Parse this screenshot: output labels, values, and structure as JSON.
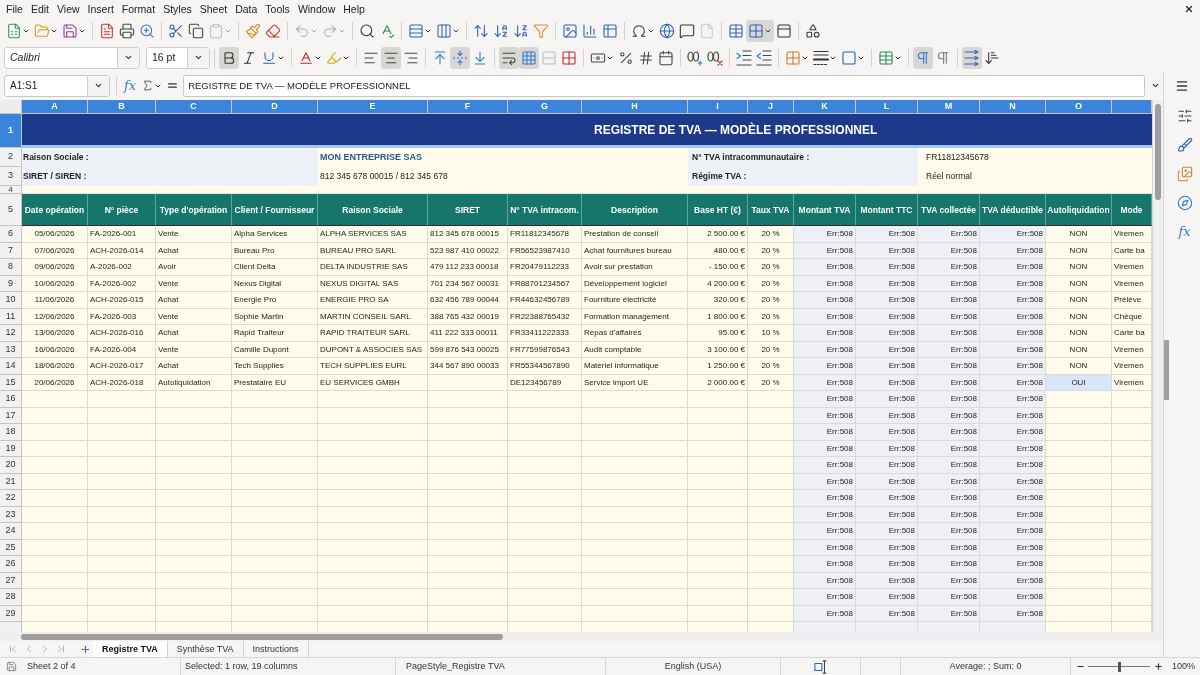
{
  "menu_bar": {
    "items": [
      "File",
      "Edit",
      "View",
      "Insert",
      "Format",
      "Styles",
      "Sheet",
      "Data",
      "Tools",
      "Window",
      "Help"
    ]
  },
  "standard_toolbar": {
    "buttons": [
      {
        "on": false,
        "disabled": false
      },
      {
        "on": false,
        "disabled": false
      },
      {
        "on": false,
        "disabled": false
      },
      {
        "on": false,
        "disabled": false
      },
      {
        "on": false,
        "disabled": false
      },
      {
        "on": false,
        "disabled": false
      },
      {
        "on": false,
        "disabled": false
      },
      {
        "on": false,
        "disabled": false
      },
      {
        "on": false,
        "disabled": true
      },
      {
        "on": false,
        "disabled": false
      },
      {
        "on": false,
        "disabled": false
      },
      {
        "on": false,
        "disabled": true
      },
      {
        "on": false,
        "disabled": true
      },
      {
        "on": false,
        "disabled": false
      },
      {
        "on": false,
        "disabled": false
      },
      {
        "on": false,
        "disabled": false
      },
      {
        "on": false,
        "disabled": false
      },
      {
        "on": false,
        "disabled": false
      },
      {
        "on": false,
        "disabled": false
      },
      {
        "on": false,
        "disabled": false
      },
      {
        "on": false,
        "disabled": false
      },
      {
        "on": false,
        "disabled": false
      },
      {
        "on": false,
        "disabled": false
      },
      {
        "on": false,
        "disabled": false
      },
      {
        "on": false,
        "disabled": false
      },
      {
        "on": false,
        "disabled": false
      },
      {
        "on": false,
        "disabled": false
      },
      {
        "on": false,
        "disabled": true
      },
      {
        "on": false,
        "disabled": false
      },
      {
        "on": true,
        "disabled": false
      },
      {
        "on": false,
        "disabled": false
      },
      {
        "on": false,
        "disabled": false
      }
    ]
  },
  "formatting_toolbar": {
    "font_name": "Calibri",
    "font_size": "16 pt",
    "buttons": [
      {
        "on": true,
        "disabled": false
      },
      {
        "on": false,
        "disabled": false
      },
      {
        "on": false,
        "disabled": false
      },
      {
        "on": false,
        "disabled": false
      },
      {
        "on": false,
        "disabled": false
      },
      {
        "on": false,
        "disabled": false
      },
      {
        "on": true,
        "disabled": false
      },
      {
        "on": false,
        "disabled": false
      },
      {
        "on": false,
        "disabled": false
      },
      {
        "on": true,
        "disabled": false
      },
      {
        "on": false,
        "disabled": false
      },
      {
        "on": true,
        "disabled": false
      },
      {
        "on": true,
        "disabled": false
      },
      {
        "on": false,
        "disabled": true
      },
      {
        "on": false,
        "disabled": false
      },
      {
        "on": false,
        "disabled": false
      },
      {
        "on": false,
        "disabled": false
      },
      {
        "on": false,
        "disabled": false
      },
      {
        "on": false,
        "disabled": false
      },
      {
        "on": false,
        "disabled": false
      },
      {
        "on": false,
        "disabled": false
      },
      {
        "on": false,
        "disabled": false
      },
      {
        "on": false,
        "disabled": false
      },
      {
        "on": false,
        "disabled": false
      },
      {
        "on": false,
        "disabled": false
      },
      {
        "on": false,
        "disabled": false
      },
      {
        "on": false,
        "disabled": false
      },
      {
        "on": true,
        "disabled": false
      },
      {
        "on": false,
        "disabled": false
      },
      {
        "on": true,
        "disabled": false
      },
      {
        "on": false,
        "disabled": false
      }
    ]
  },
  "formula_bar": {
    "name_box": "A1:S1",
    "function_wizard": "fx",
    "formula": "REGISTRE DE TVA — MODÈLE PROFESSIONNEL"
  },
  "sheet": {
    "columns": [
      {
        "letter": "A",
        "selected": true
      },
      {
        "letter": "B",
        "selected": true
      },
      {
        "letter": "C",
        "selected": true
      },
      {
        "letter": "D",
        "selected": true
      },
      {
        "letter": "E",
        "selected": true
      },
      {
        "letter": "F",
        "selected": true
      },
      {
        "letter": "G",
        "selected": true
      },
      {
        "letter": "H",
        "selected": true
      },
      {
        "letter": "I",
        "selected": true
      },
      {
        "letter": "J",
        "selected": true
      },
      {
        "letter": "K",
        "selected": true
      },
      {
        "letter": "L",
        "selected": true
      },
      {
        "letter": "M",
        "selected": true
      },
      {
        "letter": "N",
        "selected": true
      },
      {
        "letter": "O",
        "selected": true
      },
      {
        "selected": true
      }
    ],
    "title_row": {
      "row": "1",
      "selected": true,
      "title": "REGISTRE DE TVA — MODÈLE PROFESSIONNEL"
    },
    "info_rows": [
      {
        "row": "2",
        "selected": false,
        "label": "Raison Sociale :",
        "value": "MON ENTREPRISE SAS",
        "value_emphasis": true,
        "label_2": "N° TVA intracommunautaire :",
        "value_2": "FR11812345678"
      },
      {
        "row": "3",
        "selected": false,
        "label": "SIRET / SIREN :",
        "value": "812 345 678 00015 / 812 345 678",
        "value_emphasis": false,
        "label_2": "Régime TVA :",
        "value_2": "Réel normal"
      }
    ],
    "spacer_row": {
      "row": "4",
      "selected": false
    },
    "header_row": {
      "row": "5",
      "selected": false,
      "cells": [
        "Date opération",
        "N° pièce",
        "Type d'opération",
        "Client / Fournisseur",
        "Raison Sociale",
        "SIRET",
        "N° TVA intracom.",
        "Description",
        "Base HT (€)",
        "Taux TVA",
        "Montant TVA",
        "Montant TTC",
        "TVA collectée",
        "TVA déductible",
        "Autoliquidation",
        "Mode"
      ]
    },
    "rows": [
      {
        "row": "6",
        "selected": false,
        "autoliquidation_highlighted": false,
        "cells": {
          "date": "05/06/2026",
          "piece": "FA-2026-001",
          "type": "Vente",
          "client": "Alpha Services",
          "raison_sociale": "ALPHA SERVICES SAS",
          "siret": "812 345 678 00015",
          "tva_intracom": "FR11812345678",
          "description": "Prestation de conseil",
          "base_ht": "2 500.00 €",
          "taux_tva": "20 %",
          "montant_tva": "Err:508",
          "montant_ttc": "Err:508",
          "tva_collectee": "Err:508",
          "tva_deductible": "Err:508",
          "autoliquidation": "NON",
          "mode": "Viremen"
        }
      },
      {
        "row": "7",
        "selected": false,
        "autoliquidation_highlighted": false,
        "cells": {
          "date": "07/06/2026",
          "piece": "ACH-2026-014",
          "type": "Achat",
          "client": "Bureau Pro",
          "raison_sociale": "BUREAU PRO SARL",
          "siret": "523 987 410 00022",
          "tva_intracom": "FR56523987410",
          "description": "Achat fournitures bureau",
          "base_ht": "480.00 €",
          "taux_tva": "20 %",
          "montant_tva": "Err:508",
          "montant_ttc": "Err:508",
          "tva_collectee": "Err:508",
          "tva_deductible": "Err:508",
          "autoliquidation": "NON",
          "mode": "Carte ba"
        }
      },
      {
        "row": "8",
        "selected": false,
        "autoliquidation_highlighted": false,
        "cells": {
          "date": "09/06/2026",
          "piece": "A-2026-002",
          "type": "Avoir",
          "client": "Client Delta",
          "raison_sociale": "DELTA INDUSTRIE SAS",
          "siret": "479 112 233 00018",
          "tva_intracom": "FR20479112233",
          "description": "Avoir sur prestation",
          "base_ht": "- 150.00 €",
          "taux_tva": "20 %",
          "montant_tva": "Err:508",
          "montant_ttc": "Err:508",
          "tva_collectee": "Err:508",
          "tva_deductible": "Err:508",
          "autoliquidation": "NON",
          "mode": "Viremen"
        }
      },
      {
        "row": "9",
        "selected": false,
        "autoliquidation_highlighted": false,
        "cells": {
          "date": "10/06/2026",
          "piece": "FA-2026-002",
          "type": "Vente",
          "client": "Nexus Digital",
          "raison_sociale": "NEXUS DIGITAL SAS",
          "siret": "701 234 567 00031",
          "tva_intracom": "FR88701234567",
          "description": "Développement logiciel",
          "base_ht": "4 200.00 €",
          "taux_tva": "20 %",
          "montant_tva": "Err:508",
          "montant_ttc": "Err:508",
          "tva_collectee": "Err:508",
          "tva_deductible": "Err:508",
          "autoliquidation": "NON",
          "mode": "Viremen"
        }
      },
      {
        "row": "10",
        "selected": false,
        "autoliquidation_highlighted": false,
        "cells": {
          "date": "11/06/2026",
          "piece": "ACH-2026-015",
          "type": "Achat",
          "client": "Energie Pro",
          "raison_sociale": "ENERGIE PRO SA",
          "siret": "632 456 789 00044",
          "tva_intracom": "FR44632456789",
          "description": "Fourniture électricité",
          "base_ht": "320.00 €",
          "taux_tva": "20 %",
          "montant_tva": "Err:508",
          "montant_ttc": "Err:508",
          "tva_collectee": "Err:508",
          "tva_deductible": "Err:508",
          "autoliquidation": "NON",
          "mode": "Prélève"
        }
      },
      {
        "row": "11",
        "selected": false,
        "autoliquidation_highlighted": false,
        "cells": {
          "date": "12/06/2026",
          "piece": "FA-2026-003",
          "type": "Vente",
          "client": "Sophie Martin",
          "raison_sociale": "MARTIN CONSEIL SARL",
          "siret": "388 765 432 00019",
          "tva_intracom": "FR22388765432",
          "description": "Formation management",
          "base_ht": "1 800.00 €",
          "taux_tva": "20 %",
          "montant_tva": "Err:508",
          "montant_ttc": "Err:508",
          "tva_collectee": "Err:508",
          "tva_deductible": "Err:508",
          "autoliquidation": "NON",
          "mode": "Chèque"
        }
      },
      {
        "row": "12",
        "selected": false,
        "autoliquidation_highlighted": false,
        "cells": {
          "date": "13/06/2026",
          "piece": "ACH-2026-016",
          "type": "Achat",
          "client": "Rapid Traiteur",
          "raison_sociale": "RAPID TRAITEUR SARL",
          "siret": "411 222 333 00011",
          "tva_intracom": "FR33411222333",
          "description": "Repas d'affaires",
          "base_ht": "95.00 €",
          "taux_tva": "10 %",
          "montant_tva": "Err:508",
          "montant_ttc": "Err:508",
          "tva_collectee": "Err:508",
          "tva_deductible": "Err:508",
          "autoliquidation": "NON",
          "mode": "Carte ba"
        }
      },
      {
        "row": "13",
        "selected": false,
        "autoliquidation_highlighted": false,
        "cells": {
          "date": "16/06/2026",
          "piece": "FA-2026-004",
          "type": "Vente",
          "client": "Camille Dupont",
          "raison_sociale": "DUPONT & ASSOCIES SAS",
          "siret": "599 876 543 00025",
          "tva_intracom": "FR77599876543",
          "description": "Audit comptable",
          "base_ht": "3 100.00 €",
          "taux_tva": "20 %",
          "montant_tva": "Err:508",
          "montant_ttc": "Err:508",
          "tva_collectee": "Err:508",
          "tva_deductible": "Err:508",
          "autoliquidation": "NON",
          "mode": "Viremen"
        }
      },
      {
        "row": "14",
        "selected": false,
        "autoliquidation_highlighted": false,
        "cells": {
          "date": "18/06/2026",
          "piece": "ACH-2026-017",
          "type": "Achat",
          "client": "Tech Supplies",
          "raison_sociale": "TECH SUPPLIES EURL",
          "siret": "344 567 890 00033",
          "tva_intracom": "FR55344567890",
          "description": "Matériel informatique",
          "base_ht": "1 250.00 €",
          "taux_tva": "20 %",
          "montant_tva": "Err:508",
          "montant_ttc": "Err:508",
          "tva_collectee": "Err:508",
          "tva_deductible": "Err:508",
          "autoliquidation": "NON",
          "mode": "Viremen"
        }
      },
      {
        "row": "15",
        "selected": false,
        "autoliquidation_highlighted": true,
        "cells": {
          "date": "20/06/2026",
          "piece": "ACH-2026-018",
          "type": "Autoliquidation",
          "client": "Prestataire EU",
          "raison_sociale": "EU SERVICES GMBH",
          "tva_intracom": "DE123456789",
          "description": "Service import UE",
          "base_ht": "2 000.00 €",
          "taux_tva": "20 %",
          "montant_tva": "Err:508",
          "montant_ttc": "Err:508",
          "tva_collectee": "Err:508",
          "tva_deductible": "Err:508",
          "autoliquidation": "OUI",
          "mode": "Viremen"
        }
      }
    ],
    "formula_rows": [
      {
        "row": "16",
        "selected": false,
        "cells": {
          "montant_tva": "Err:508",
          "montant_ttc": "Err:508",
          "tva_collectee": "Err:508",
          "tva_deductible": "Err:508"
        }
      },
      {
        "row": "17",
        "selected": false,
        "cells": {
          "montant_tva": "Err:508",
          "montant_ttc": "Err:508",
          "tva_collectee": "Err:508",
          "tva_deductible": "Err:508"
        }
      },
      {
        "row": "18",
        "selected": false,
        "cells": {
          "montant_tva": "Err:508",
          "montant_ttc": "Err:508",
          "tva_collectee": "Err:508",
          "tva_deductible": "Err:508"
        }
      },
      {
        "row": "19",
        "selected": false,
        "cells": {
          "montant_tva": "Err:508",
          "montant_ttc": "Err:508",
          "tva_collectee": "Err:508",
          "tva_deductible": "Err:508"
        }
      },
      {
        "row": "20",
        "selected": false,
        "cells": {
          "montant_tva": "Err:508",
          "montant_ttc": "Err:508",
          "tva_collectee": "Err:508",
          "tva_deductible": "Err:508"
        }
      },
      {
        "row": "21",
        "selected": false,
        "cells": {
          "montant_tva": "Err:508",
          "montant_ttc": "Err:508",
          "tva_collectee": "Err:508",
          "tva_deductible": "Err:508"
        }
      },
      {
        "row": "22",
        "selected": false,
        "cells": {
          "montant_tva": "Err:508",
          "montant_ttc": "Err:508",
          "tva_collectee": "Err:508",
          "tva_deductible": "Err:508"
        }
      },
      {
        "row": "23",
        "selected": false,
        "cells": {
          "montant_tva": "Err:508",
          "montant_ttc": "Err:508",
          "tva_collectee": "Err:508",
          "tva_deductible": "Err:508"
        }
      },
      {
        "row": "24",
        "selected": false,
        "cells": {
          "montant_tva": "Err:508",
          "montant_ttc": "Err:508",
          "tva_collectee": "Err:508",
          "tva_deductible": "Err:508"
        }
      },
      {
        "row": "25",
        "selected": false,
        "cells": {
          "montant_tva": "Err:508",
          "montant_ttc": "Err:508",
          "tva_collectee": "Err:508",
          "tva_deductible": "Err:508"
        }
      },
      {
        "row": "26",
        "selected": false,
        "cells": {
          "montant_tva": "Err:508",
          "montant_ttc": "Err:508",
          "tva_collectee": "Err:508",
          "tva_deductible": "Err:508"
        }
      },
      {
        "row": "27",
        "selected": false,
        "cells": {
          "montant_tva": "Err:508",
          "montant_ttc": "Err:508",
          "tva_collectee": "Err:508",
          "tva_deductible": "Err:508"
        }
      },
      {
        "row": "28",
        "selected": false,
        "cells": {
          "montant_tva": "Err:508",
          "montant_ttc": "Err:508",
          "tva_collectee": "Err:508",
          "tva_deductible": "Err:508"
        }
      },
      {
        "row": "29",
        "selected": false,
        "cells": {
          "montant_tva": "Err:508",
          "montant_ttc": "Err:508",
          "tva_collectee": "Err:508",
          "tva_deductible": "Err:508"
        }
      }
    ]
  },
  "sidebar": {
    "functions_label": "fx"
  },
  "sheet_tabs": {
    "navigation_disabled": true,
    "tabs": [
      {
        "label": "Registre TVA",
        "selected": true
      },
      {
        "label": "Synthèse TVA",
        "selected": false
      },
      {
        "label": "Instructions",
        "selected": false
      }
    ]
  },
  "status_bar": {
    "sheet": "Sheet 2 of 4",
    "selection": "Selected: 1 row, 19 columns",
    "page_style": "PageStyle_Registre TVA",
    "language": "English (USA)",
    "summary": "Average: ; Sum: 0",
    "zoom": {
      "level": 0.5,
      "reading": "100%"
    }
  }
}
